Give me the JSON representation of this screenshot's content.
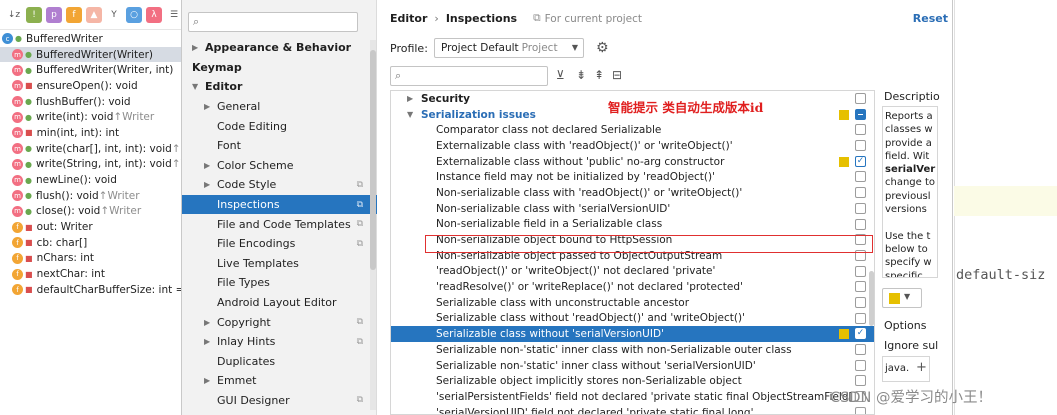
{
  "structure": {
    "root": "BufferedWriter",
    "items": [
      {
        "kind": "m",
        "lock": "green",
        "label": "BufferedWriter(Writer)",
        "inherited": "",
        "selected": true
      },
      {
        "kind": "m",
        "lock": "green",
        "label": "BufferedWriter(Writer, int)",
        "inherited": ""
      },
      {
        "kind": "m",
        "lock": "red",
        "label": "ensureOpen(): void",
        "inherited": ""
      },
      {
        "kind": "m",
        "lock": "green",
        "label": "flushBuffer(): void",
        "inherited": ""
      },
      {
        "kind": "m",
        "lock": "green",
        "label": "write(int): void ",
        "inherited": "↑Writer"
      },
      {
        "kind": "m",
        "lock": "red",
        "label": "min(int, int): int",
        "inherited": ""
      },
      {
        "kind": "m",
        "lock": "green",
        "label": "write(char[], int, int): void ",
        "inherited": "↑Writ"
      },
      {
        "kind": "m",
        "lock": "green",
        "label": "write(String, int, int): void ",
        "inherited": "↑Writ"
      },
      {
        "kind": "m",
        "lock": "green",
        "label": "newLine(): void",
        "inherited": ""
      },
      {
        "kind": "m",
        "lock": "green",
        "label": "flush(): void ",
        "inherited": "↑Writer"
      },
      {
        "kind": "m",
        "lock": "green",
        "label": "close(): void ",
        "inherited": "↑Writer"
      },
      {
        "kind": "f",
        "lock": "red",
        "label": "out: Writer",
        "inherited": ""
      },
      {
        "kind": "f",
        "lock": "red",
        "label": "cb: char[]",
        "inherited": ""
      },
      {
        "kind": "f",
        "lock": "red",
        "label": "nChars: int",
        "inherited": ""
      },
      {
        "kind": "f",
        "lock": "red",
        "label": "nextChar: int",
        "inherited": ""
      },
      {
        "kind": "f",
        "lock": "red",
        "label": "defaultCharBufferSize: int = 819",
        "inherited": ""
      }
    ]
  },
  "nav": {
    "items": [
      {
        "level": 0,
        "arrow": "▶",
        "label": "Appearance & Behavior"
      },
      {
        "level": 0,
        "arrow": "",
        "label": "Keymap"
      },
      {
        "level": 0,
        "arrow": "▼",
        "label": "Editor"
      },
      {
        "level": 1,
        "arrow": "▶",
        "label": "General"
      },
      {
        "level": 1,
        "arrow": "",
        "label": "Code Editing"
      },
      {
        "level": 1,
        "arrow": "",
        "label": "Font"
      },
      {
        "level": 1,
        "arrow": "▶",
        "label": "Color Scheme"
      },
      {
        "level": 1,
        "arrow": "▶",
        "label": "Code Style",
        "page": true
      },
      {
        "level": 1,
        "arrow": "",
        "label": "Inspections",
        "page": true,
        "selected": true
      },
      {
        "level": 1,
        "arrow": "",
        "label": "File and Code Templates",
        "page": true
      },
      {
        "level": 1,
        "arrow": "",
        "label": "File Encodings",
        "page": true
      },
      {
        "level": 1,
        "arrow": "",
        "label": "Live Templates"
      },
      {
        "level": 1,
        "arrow": "",
        "label": "File Types"
      },
      {
        "level": 1,
        "arrow": "",
        "label": "Android Layout Editor"
      },
      {
        "level": 1,
        "arrow": "▶",
        "label": "Copyright",
        "page": true
      },
      {
        "level": 1,
        "arrow": "▶",
        "label": "Inlay Hints",
        "page": true
      },
      {
        "level": 1,
        "arrow": "",
        "label": "Duplicates"
      },
      {
        "level": 1,
        "arrow": "▶",
        "label": "Emmet"
      },
      {
        "level": 1,
        "arrow": "",
        "label": "GUI Designer",
        "page": true
      }
    ]
  },
  "breadcrumb": {
    "first": "Editor",
    "sep": "›",
    "second": "Inspections",
    "scope": "For current project"
  },
  "reset_label": "Reset",
  "profile": {
    "label": "Profile:",
    "value": "Project Default",
    "scope": "Project"
  },
  "annotation": "智能提示 类自动生成版本id",
  "tree": [
    {
      "type": "grp",
      "arrow": "▶",
      "label": "Security",
      "check": "none"
    },
    {
      "type": "grp",
      "arrow": "▼",
      "label": "Serialization issues",
      "check": "partial",
      "blue": true,
      "sev": true
    },
    {
      "type": "child",
      "label": "Comparator class not declared Serializable",
      "check": "none"
    },
    {
      "type": "child",
      "label": "Externalizable class with 'readObject()' or 'writeObject()'",
      "check": "none"
    },
    {
      "type": "child",
      "label": "Externalizable class without 'public' no-arg constructor",
      "check": "on",
      "sev": true
    },
    {
      "type": "child",
      "label": "Instance field may not be initialized by 'readObject()'",
      "check": "none"
    },
    {
      "type": "child",
      "label": "Non-serializable class with 'readObject()' or 'writeObject()'",
      "check": "none"
    },
    {
      "type": "child",
      "label": "Non-serializable class with 'serialVersionUID'",
      "check": "none"
    },
    {
      "type": "child",
      "label": "Non-serializable field in a Serializable class",
      "check": "none"
    },
    {
      "type": "child",
      "label": "Non-serializable object bound to HttpSession",
      "check": "none"
    },
    {
      "type": "child",
      "label": "Non-serializable object passed to ObjectOutputStream",
      "check": "none"
    },
    {
      "type": "child",
      "label": "'readObject()' or 'writeObject()' not declared 'private'",
      "check": "none"
    },
    {
      "type": "child",
      "label": "'readResolve()' or 'writeReplace()' not declared 'protected'",
      "check": "none"
    },
    {
      "type": "child",
      "label": "Serializable class with unconstructable ancestor",
      "check": "none"
    },
    {
      "type": "child",
      "label": "Serializable class without 'readObject()' and 'writeObject()'",
      "check": "none"
    },
    {
      "type": "child",
      "label": "Serializable class without 'serialVersionUID'",
      "check": "on",
      "sev": true,
      "selected": true
    },
    {
      "type": "child",
      "label": "Serializable non-'static' inner class with non-Serializable outer class",
      "check": "none"
    },
    {
      "type": "child",
      "label": "Serializable non-'static' inner class without 'serialVersionUID'",
      "check": "none"
    },
    {
      "type": "child",
      "label": "Serializable object implicitly stores non-Serializable object",
      "check": "none"
    },
    {
      "type": "child",
      "label": "'serialPersistentFields' field not declared 'private static final ObjectStreamField[]'",
      "check": "none"
    },
    {
      "type": "child",
      "label": "'serialVersionUID' field not declared 'private static final long'",
      "check": "none"
    }
  ],
  "description": {
    "title": "Descriptio",
    "lines": [
      "Reports a",
      "classes w",
      "provide a",
      "field. Wit",
      "serialVer",
      "change to",
      "previousl",
      "versions",
      "",
      "Use the t",
      "below to",
      "specify w",
      "specific"
    ],
    "bold_index": 4
  },
  "options_label": "Options",
  "ignore_label": "Ignore sul",
  "java_value": "java.",
  "editor_code": "default-siz",
  "watermark": "CSDN @爱学习的小王！"
}
